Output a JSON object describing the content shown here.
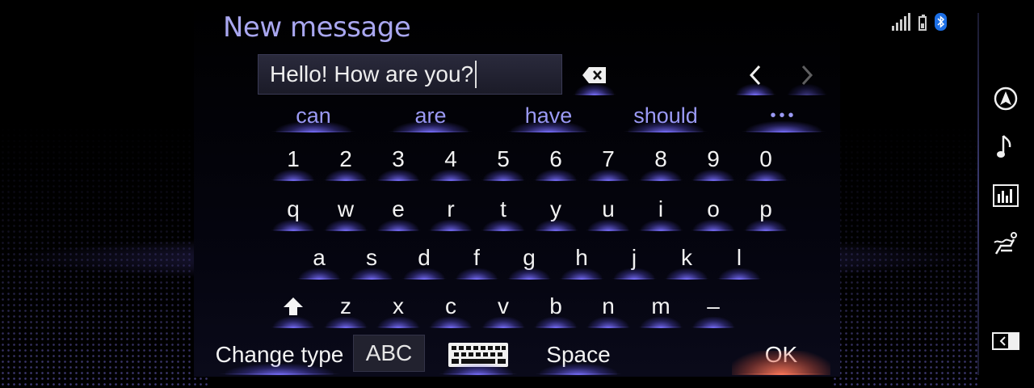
{
  "header": {
    "title": "New message"
  },
  "input": {
    "value": "Hello! How are you?"
  },
  "suggestions": [
    "can",
    "are",
    "have",
    "should",
    "•••"
  ],
  "keyboard": {
    "numbers": [
      "1",
      "2",
      "3",
      "4",
      "5",
      "6",
      "7",
      "8",
      "9",
      "0"
    ],
    "row1": [
      "q",
      "w",
      "e",
      "r",
      "t",
      "y",
      "u",
      "i",
      "o",
      "p"
    ],
    "row2": [
      "a",
      "s",
      "d",
      "f",
      "g",
      "h",
      "j",
      "k",
      "l"
    ],
    "row3": [
      "z",
      "x",
      "c",
      "v",
      "b",
      "n",
      "m",
      "–"
    ]
  },
  "bottom": {
    "change_type_label": "Change type",
    "mode_label": "ABC",
    "space_label": "Space",
    "ok_label": "OK"
  },
  "icons": {
    "backspace": "backspace-icon",
    "arrow_left": "chevron-left-icon",
    "arrow_right": "chevron-right-icon",
    "shift": "shift-icon",
    "keyboard": "keyboard-icon",
    "signal": "signal-icon",
    "battery": "battery-icon",
    "bluetooth": "bluetooth-icon",
    "rail": [
      "navigation-icon",
      "music-icon",
      "equalizer-icon",
      "climate-seat-icon",
      "display-split-icon"
    ]
  },
  "colors": {
    "accent": "#a9a7f0",
    "suggestion": "#9b9af5",
    "ok_glow": "#ff785a",
    "bluetooth": "#1c6fe6"
  }
}
